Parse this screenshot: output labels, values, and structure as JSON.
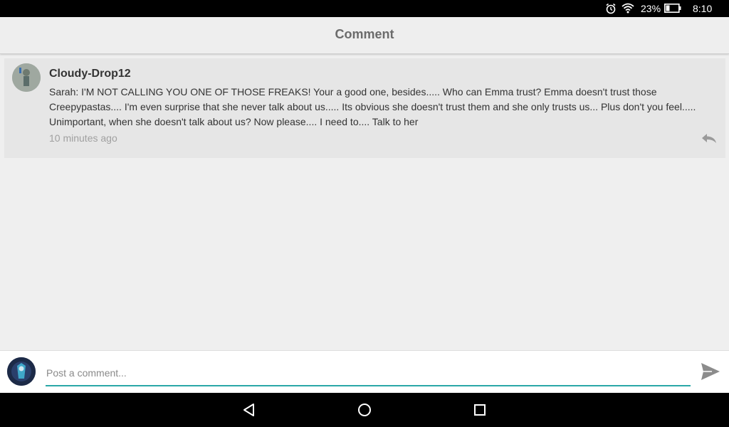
{
  "status_bar": {
    "battery_percent": "23%",
    "time": "8:10",
    "icons": [
      "alarm-icon",
      "wifi-icon",
      "battery-icon"
    ]
  },
  "header": {
    "title": "Comment"
  },
  "comment": {
    "username": "Cloudy-Drop12",
    "text": "Sarah: I'M NOT CALLING YOU ONE OF THOSE FREAKS! Your a good one, besides..... Who can Emma trust? Emma doesn't trust those Creepypastas.... I'm even surprise that she never talk about us..... Its obvious she doesn't trust them and she only trusts us... Plus don't you feel..... Unimportant, when she doesn't talk about us? Now please.... I need to.... Talk to her",
    "timestamp": "10 minutes ago",
    "reply_icon": "reply-icon"
  },
  "composer": {
    "placeholder": "Post a comment...",
    "value": "",
    "send_icon": "send-icon"
  },
  "nav_bar": {
    "buttons": [
      "back-icon",
      "home-icon",
      "recents-icon"
    ]
  },
  "colors": {
    "accent": "#2aa7a7",
    "background": "#efefef",
    "card": "#e6e6e6"
  }
}
